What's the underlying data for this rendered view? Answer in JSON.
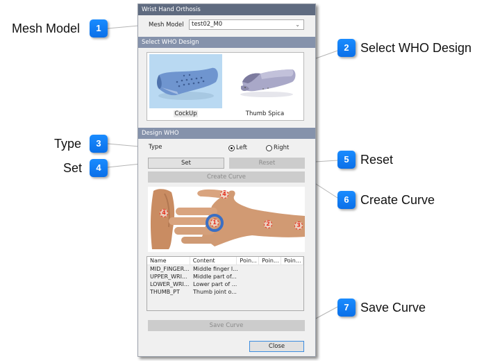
{
  "dialog": {
    "title": "Wrist Hand Orthosis",
    "mesh_model": {
      "label": "Mesh Model",
      "value": "test02_M0",
      "chevron_icon": "chevron-down-icon"
    },
    "select_design": {
      "header": "Select WHO Design",
      "options": [
        {
          "label": "CockUp",
          "selected": true,
          "image": "cockup-orthosis-render"
        },
        {
          "label": "Thumb Spica",
          "selected": false,
          "image": "thumb-spica-orthosis-render"
        }
      ]
    },
    "design_who": {
      "header": "Design WHO",
      "type_label": "Type",
      "radio": [
        {
          "label": "Left",
          "checked": true
        },
        {
          "label": "Right",
          "checked": false
        }
      ],
      "set_label": "Set",
      "reset_label": "Reset",
      "create_curve_label": "Create Curve",
      "hand_image": {
        "markers": [
          {
            "num": "4",
            "where": "side-hand"
          },
          {
            "num": "4",
            "where": "thumb-tip"
          },
          {
            "num": "1",
            "where": "middle-finger-knuckle",
            "selected": true
          },
          {
            "num": "2",
            "where": "upper-wrist"
          },
          {
            "num": "3",
            "where": "lower-wrist"
          }
        ]
      },
      "table": {
        "columns": [
          "Name",
          "Content",
          "Poin...",
          "Poin...",
          "Poin..."
        ],
        "rows": [
          [
            "MID_FINGER...",
            "Middle finger l...",
            "",
            "",
            ""
          ],
          [
            "UPPER_WRI...",
            "Middle part of...",
            "",
            "",
            ""
          ],
          [
            "LOWER_WRI...",
            "Lower part of ...",
            "",
            "",
            ""
          ],
          [
            "THUMB_PT",
            "Thumb joint o...",
            "",
            "",
            ""
          ]
        ]
      },
      "save_curve_label": "Save Curve"
    },
    "close_label": "Close"
  },
  "callouts": [
    {
      "num": "1",
      "label": "Mesh Model"
    },
    {
      "num": "2",
      "label": "Select WHO Design"
    },
    {
      "num": "3",
      "label": "Type"
    },
    {
      "num": "4",
      "label": "Set"
    },
    {
      "num": "5",
      "label": "Reset"
    },
    {
      "num": "6",
      "label": "Create Curve"
    },
    {
      "num": "7",
      "label": "Save Curve"
    }
  ],
  "colors": {
    "title_bar": "#5f6b80",
    "section_header": "#8592ab",
    "callout_badge": "#0a7af0",
    "selected_tile": "#b9d9f2",
    "marker_red": "#e53020",
    "selected_ring": "#3a6fc4"
  }
}
